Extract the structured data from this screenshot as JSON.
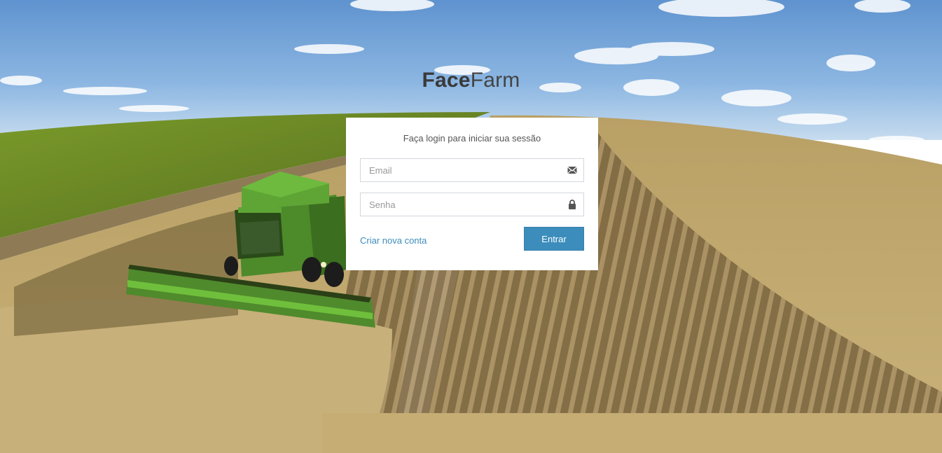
{
  "logo": {
    "bold": "Face",
    "light": "Farm"
  },
  "login": {
    "message": "Faça login para iniciar sua sessão",
    "email_placeholder": "Email",
    "email_value": "",
    "password_placeholder": "Senha",
    "password_value": "",
    "register_link": "Criar nova conta",
    "submit_label": "Entrar"
  },
  "icons": {
    "email": "envelope-icon",
    "password": "lock-icon"
  },
  "colors": {
    "primary": "#3c8dbc",
    "box_bg": "#ffffff"
  }
}
